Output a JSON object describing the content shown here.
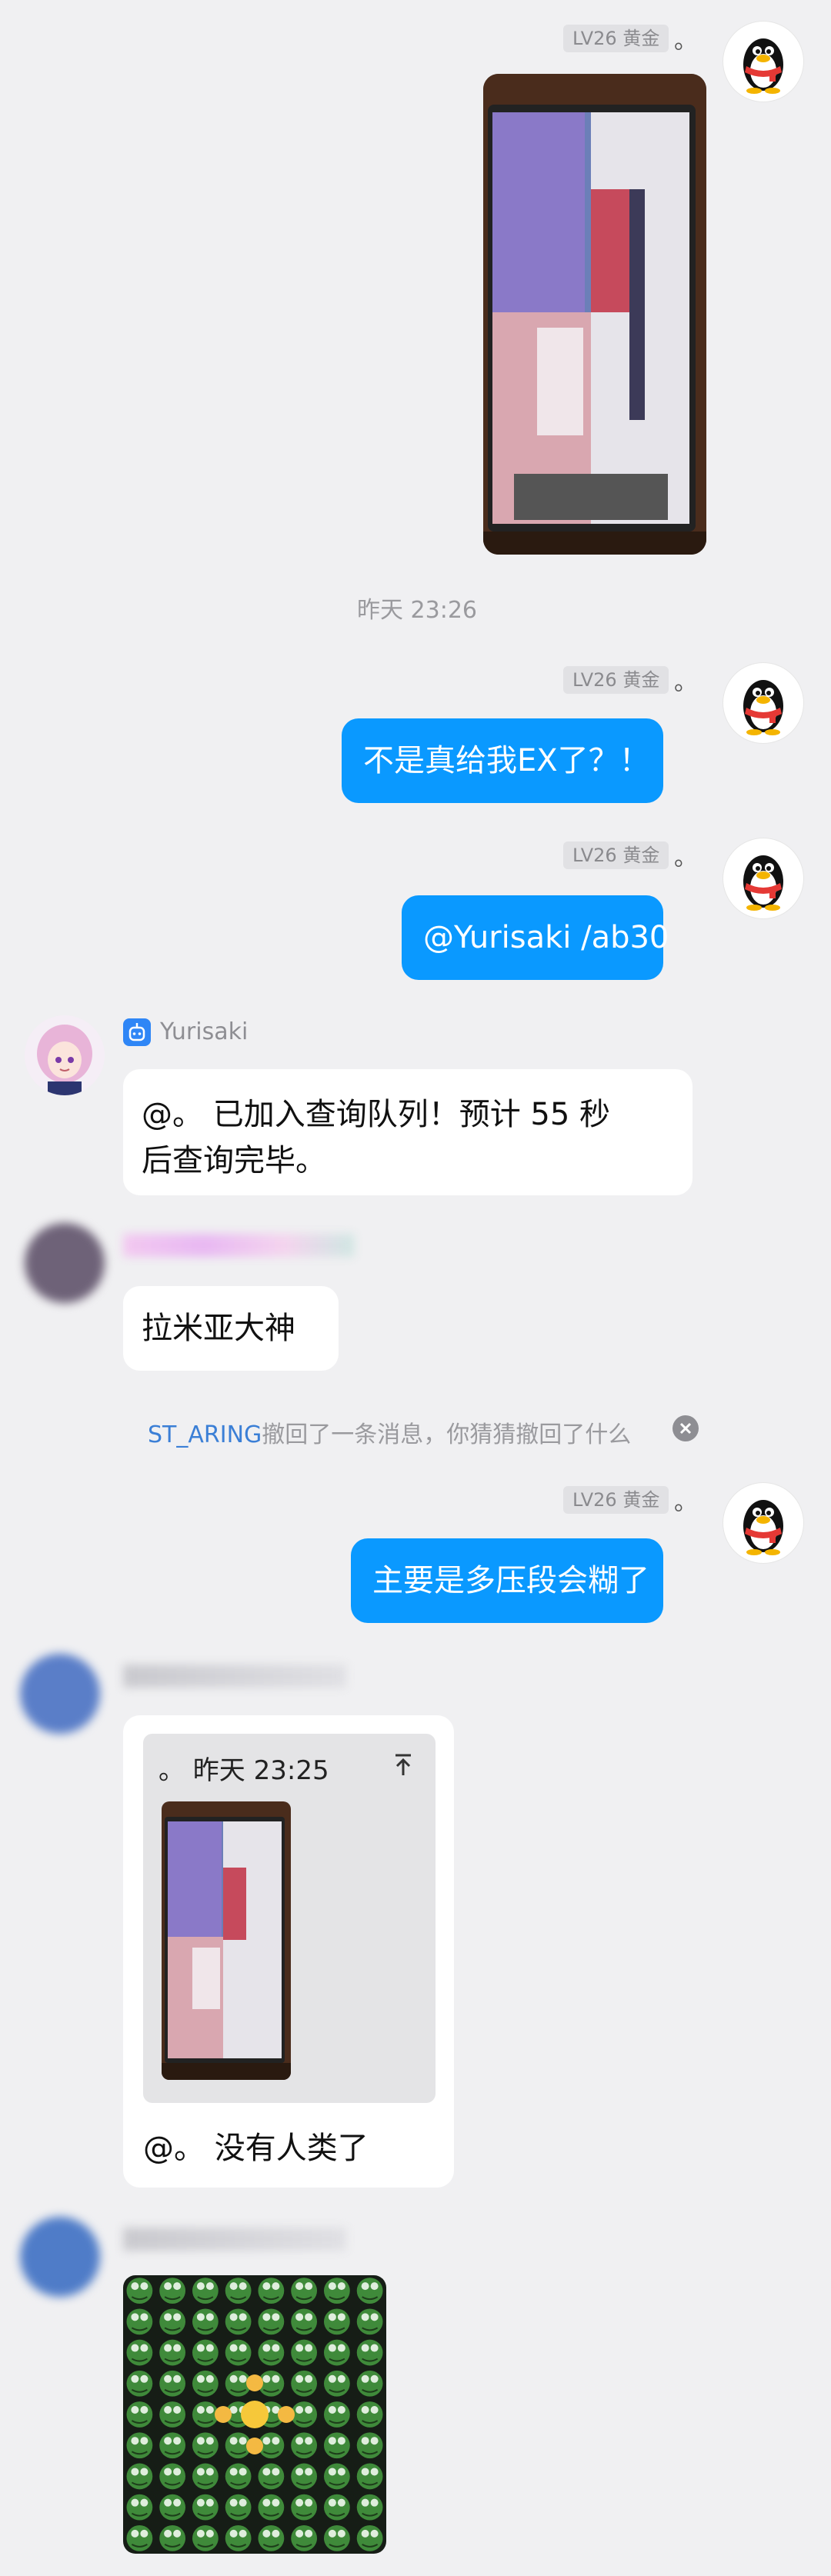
{
  "messages": {
    "self_nick": "。",
    "self_badge": "LV26 黄金",
    "timestamp1": "昨天 23:26",
    "msg2_text": "不是真给我EX了？！",
    "msg3_text": "@Yurisaki /ab30",
    "bot_name": "Yurisaki",
    "bot_reply_line1": "@。 已加入查询队列！预计 55 秒",
    "bot_reply_line2": "后查询完毕。",
    "user2_text": "拉米亚大神",
    "recall_name": "ST_ARING",
    "recall_text": "撤回了一条消息，你猜猜撤回了什么",
    "msg4_text": "主要是多压段会糊了",
    "quote_header": "。 昨天 23:25",
    "reply_text": "@。 没有人类了"
  },
  "colors": {
    "bubble_self": "#0a99ff",
    "link": "#3b7fd6",
    "background": "#f0f0f2"
  },
  "icons": {
    "self_avatar": "qq-penguin-icon",
    "bot_badge": "robot-icon",
    "recall_close": "close-circle-icon",
    "quote_jump": "arrow-up-icon",
    "meme": "pepe-frog-grid-with-pointing-emoji"
  }
}
